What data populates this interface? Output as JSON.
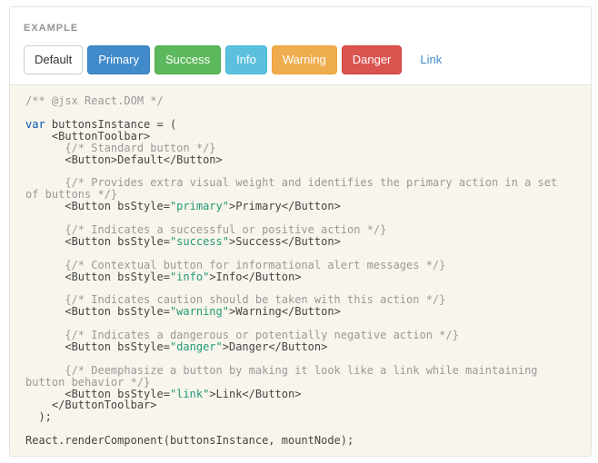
{
  "example": {
    "label": "EXAMPLE",
    "buttons": [
      {
        "label": "Default",
        "style": "default"
      },
      {
        "label": "Primary",
        "style": "primary"
      },
      {
        "label": "Success",
        "style": "success"
      },
      {
        "label": "Info",
        "style": "info"
      },
      {
        "label": "Warning",
        "style": "warning"
      },
      {
        "label": "Danger",
        "style": "danger"
      },
      {
        "label": "Link",
        "style": "link"
      }
    ]
  },
  "code": {
    "lines": [
      [
        {
          "t": "/** @jsx React.DOM */",
          "c": "cm"
        }
      ],
      [],
      [
        {
          "t": "var",
          "c": "kw"
        },
        {
          "t": " buttonsInstance = ("
        }
      ],
      [
        {
          "t": "    <ButtonToolbar>"
        }
      ],
      [
        {
          "t": "      {/* Standard button */}",
          "c": "cm"
        }
      ],
      [
        {
          "t": "      <Button>Default</Button>"
        }
      ],
      [],
      [
        {
          "t": "      {/* Provides extra visual weight and identifies the primary action in a set",
          "c": "cm"
        }
      ],
      [
        {
          "t": "of buttons */}",
          "c": "cm"
        }
      ],
      [
        {
          "t": "      <Button bsStyle="
        },
        {
          "t": "\"primary\"",
          "c": "st"
        },
        {
          "t": ">Primary</Button>"
        }
      ],
      [],
      [
        {
          "t": "      {/* Indicates a successful or positive action */}",
          "c": "cm"
        }
      ],
      [
        {
          "t": "      <Button bsStyle="
        },
        {
          "t": "\"success\"",
          "c": "st"
        },
        {
          "t": ">Success</Button>"
        }
      ],
      [],
      [
        {
          "t": "      {/* Contextual button for informational alert messages */}",
          "c": "cm"
        }
      ],
      [
        {
          "t": "      <Button bsStyle="
        },
        {
          "t": "\"info\"",
          "c": "st"
        },
        {
          "t": ">Info</Button>"
        }
      ],
      [],
      [
        {
          "t": "      {/* Indicates caution should be taken with this action */}",
          "c": "cm"
        }
      ],
      [
        {
          "t": "      <Button bsStyle="
        },
        {
          "t": "\"warning\"",
          "c": "st"
        },
        {
          "t": ">Warning</Button>"
        }
      ],
      [],
      [
        {
          "t": "      {/* Indicates a dangerous or potentially negative action */}",
          "c": "cm"
        }
      ],
      [
        {
          "t": "      <Button bsStyle="
        },
        {
          "t": "\"danger\"",
          "c": "st"
        },
        {
          "t": ">Danger</Button>"
        }
      ],
      [],
      [
        {
          "t": "      {/* Deemphasize a button by making it look like a link while maintaining",
          "c": "cm"
        }
      ],
      [
        {
          "t": "button behavior */}",
          "c": "cm"
        }
      ],
      [
        {
          "t": "      <Button bsStyle="
        },
        {
          "t": "\"link\"",
          "c": "st"
        },
        {
          "t": ">Link</Button>"
        }
      ],
      [
        {
          "t": "    </ButtonToolbar>"
        }
      ],
      [
        {
          "t": "  );"
        }
      ],
      [],
      [
        {
          "t": "React.renderComponent(buttonsInstance, mountNode);"
        }
      ]
    ]
  },
  "colors": {
    "primary": "#428bca",
    "success": "#5cb85c",
    "info": "#5bc0de",
    "warning": "#f0ad4e",
    "danger": "#d9534f",
    "code_background": "#f8f5ec"
  }
}
